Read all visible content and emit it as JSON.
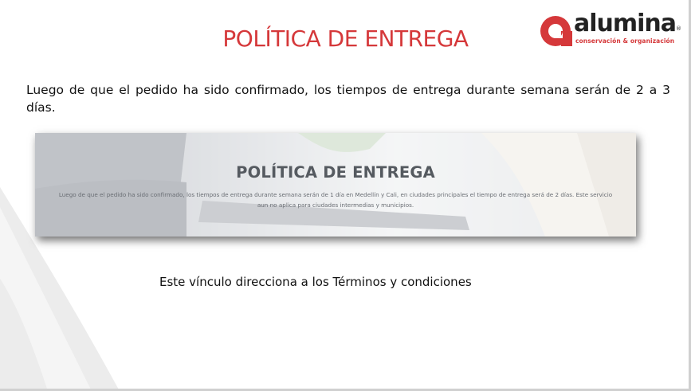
{
  "slide": {
    "title": "POLÍTICA DE ENTREGA",
    "intro_text": "Luego de que el pedido ha sido confirmado, los tiempos de entrega durante semana serán de 2 a 3 días.",
    "link_note": "Este vínculo direcciona a los Términos y condiciones"
  },
  "logo": {
    "wordmark": "alumina",
    "trademark": "®",
    "tagline": "conservación & organización",
    "icon": "alumina-logo-icon"
  },
  "embedded_screenshot": {
    "title": "POLÍTICA DE ENTREGA",
    "body": "Luego de que el pedido ha sido confirmado, los tiempos de entrega durante semana serán de 1 día en Medellín y Cali, en ciudades principales el tiempo de entrega será de 2 días. Este servicio aun no aplica para ciudades intermedias y municipios."
  },
  "colors": {
    "title_red": "#d5383a",
    "logo_red": "#d5383a",
    "text_dark": "#111111",
    "swoosh_gray": "#f1f1f1"
  }
}
